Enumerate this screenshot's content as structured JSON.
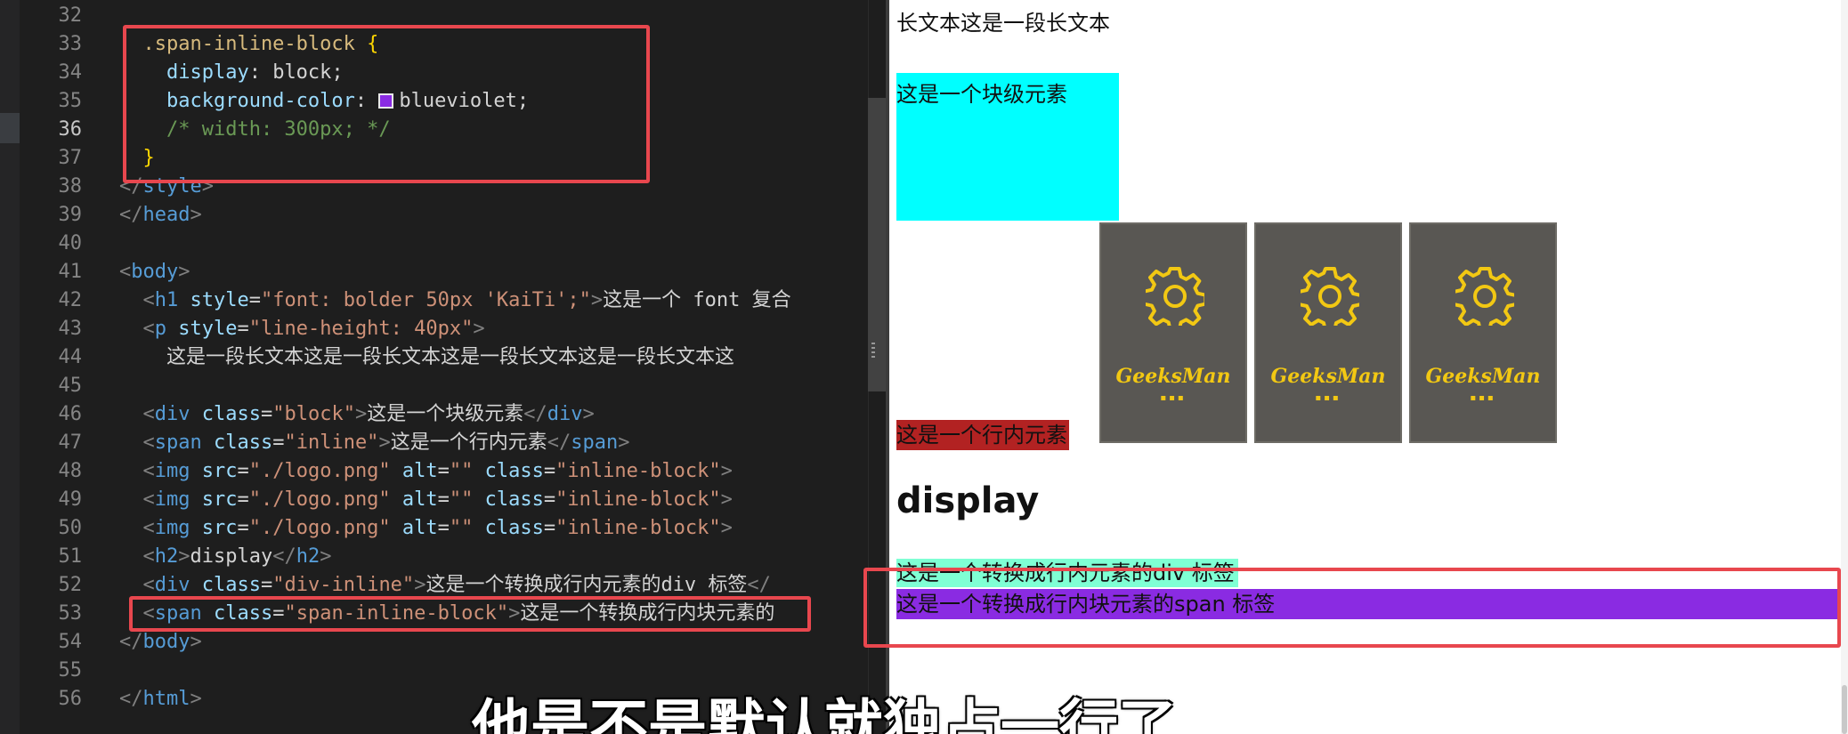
{
  "editor": {
    "lines": [
      {
        "n": "32",
        "tokens": [
          {
            "t": "",
            "c": "t-text"
          }
        ]
      },
      {
        "n": "33",
        "tokens": [
          {
            "t": "  .span-inline-block ",
            "c": "t-sel"
          },
          {
            "t": "{",
            "c": "t-brace"
          }
        ]
      },
      {
        "n": "34",
        "tokens": [
          {
            "t": "    display",
            "c": "t-attr"
          },
          {
            "t": ": block;",
            "c": "t-text"
          }
        ]
      },
      {
        "n": "35",
        "tokens": [
          {
            "t": "    background-color",
            "c": "t-attr"
          },
          {
            "t": ": ",
            "c": "t-text"
          },
          {
            "swatch": "#8a2be2"
          },
          {
            "t": "blueviolet;",
            "c": "t-text"
          }
        ]
      },
      {
        "n": "36",
        "tokens": [
          {
            "t": "    /* width: 300px; */",
            "c": "t-comment"
          }
        ]
      },
      {
        "n": "37",
        "tokens": [
          {
            "t": "  ",
            "c": "t-text"
          },
          {
            "t": "}",
            "c": "t-brace"
          }
        ]
      },
      {
        "n": "38",
        "tokens": [
          {
            "t": "</",
            "c": "t-tag"
          },
          {
            "t": "style",
            "c": "t-name"
          },
          {
            "t": ">",
            "c": "t-tag"
          }
        ]
      },
      {
        "n": "39",
        "tokens": [
          {
            "t": "</",
            "c": "t-tag"
          },
          {
            "t": "head",
            "c": "t-name"
          },
          {
            "t": ">",
            "c": "t-tag"
          }
        ]
      },
      {
        "n": "40",
        "tokens": [
          {
            "t": "",
            "c": "t-text"
          }
        ]
      },
      {
        "n": "41",
        "tokens": [
          {
            "t": "<",
            "c": "t-tag"
          },
          {
            "t": "body",
            "c": "t-name"
          },
          {
            "t": ">",
            "c": "t-tag"
          }
        ]
      },
      {
        "n": "42",
        "tokens": [
          {
            "t": "  <",
            "c": "t-tag"
          },
          {
            "t": "h1",
            "c": "t-name"
          },
          {
            "t": " style",
            "c": "t-attr"
          },
          {
            "t": "=",
            "c": "t-text"
          },
          {
            "t": "\"font: bolder 50px 'KaiTi';\"",
            "c": "t-str"
          },
          {
            "t": ">",
            "c": "t-tag"
          },
          {
            "t": "这是一个 font 复合",
            "c": "t-text"
          }
        ]
      },
      {
        "n": "43",
        "tokens": [
          {
            "t": "  <",
            "c": "t-tag"
          },
          {
            "t": "p",
            "c": "t-name"
          },
          {
            "t": " style",
            "c": "t-attr"
          },
          {
            "t": "=",
            "c": "t-text"
          },
          {
            "t": "\"line-height: 40px\"",
            "c": "t-str"
          },
          {
            "t": ">",
            "c": "t-tag"
          }
        ]
      },
      {
        "n": "44",
        "tokens": [
          {
            "t": "    这是一段长文本这是一段长文本这是一段长文本这是一段长文本这",
            "c": "t-text"
          }
        ]
      },
      {
        "n": "45",
        "tokens": [
          {
            "t": "",
            "c": "t-text"
          }
        ]
      },
      {
        "n": "46",
        "tokens": [
          {
            "t": "  <",
            "c": "t-tag"
          },
          {
            "t": "div",
            "c": "t-name"
          },
          {
            "t": " class",
            "c": "t-attr"
          },
          {
            "t": "=",
            "c": "t-text"
          },
          {
            "t": "\"block\"",
            "c": "t-str"
          },
          {
            "t": ">",
            "c": "t-tag"
          },
          {
            "t": "这是一个块级元素",
            "c": "t-text"
          },
          {
            "t": "</",
            "c": "t-tag"
          },
          {
            "t": "div",
            "c": "t-name"
          },
          {
            "t": ">",
            "c": "t-tag"
          }
        ]
      },
      {
        "n": "47",
        "tokens": [
          {
            "t": "  <",
            "c": "t-tag"
          },
          {
            "t": "span",
            "c": "t-name"
          },
          {
            "t": " class",
            "c": "t-attr"
          },
          {
            "t": "=",
            "c": "t-text"
          },
          {
            "t": "\"inline\"",
            "c": "t-str"
          },
          {
            "t": ">",
            "c": "t-tag"
          },
          {
            "t": "这是一个行内元素",
            "c": "t-text"
          },
          {
            "t": "</",
            "c": "t-tag"
          },
          {
            "t": "span",
            "c": "t-name"
          },
          {
            "t": ">",
            "c": "t-tag"
          }
        ]
      },
      {
        "n": "48",
        "tokens": [
          {
            "t": "  <",
            "c": "t-tag"
          },
          {
            "t": "img",
            "c": "t-name"
          },
          {
            "t": " src",
            "c": "t-attr"
          },
          {
            "t": "=",
            "c": "t-text"
          },
          {
            "t": "\"./logo.png\"",
            "c": "t-str"
          },
          {
            "t": " alt",
            "c": "t-attr"
          },
          {
            "t": "=",
            "c": "t-text"
          },
          {
            "t": "\"\"",
            "c": "t-str"
          },
          {
            "t": " class",
            "c": "t-attr"
          },
          {
            "t": "=",
            "c": "t-text"
          },
          {
            "t": "\"inline-block\"",
            "c": "t-str"
          },
          {
            "t": ">",
            "c": "t-tag"
          }
        ]
      },
      {
        "n": "49",
        "tokens": [
          {
            "t": "  <",
            "c": "t-tag"
          },
          {
            "t": "img",
            "c": "t-name"
          },
          {
            "t": " src",
            "c": "t-attr"
          },
          {
            "t": "=",
            "c": "t-text"
          },
          {
            "t": "\"./logo.png\"",
            "c": "t-str"
          },
          {
            "t": " alt",
            "c": "t-attr"
          },
          {
            "t": "=",
            "c": "t-text"
          },
          {
            "t": "\"\"",
            "c": "t-str"
          },
          {
            "t": " class",
            "c": "t-attr"
          },
          {
            "t": "=",
            "c": "t-text"
          },
          {
            "t": "\"inline-block\"",
            "c": "t-str"
          },
          {
            "t": ">",
            "c": "t-tag"
          }
        ]
      },
      {
        "n": "50",
        "tokens": [
          {
            "t": "  <",
            "c": "t-tag"
          },
          {
            "t": "img",
            "c": "t-name"
          },
          {
            "t": " src",
            "c": "t-attr"
          },
          {
            "t": "=",
            "c": "t-text"
          },
          {
            "t": "\"./logo.png\"",
            "c": "t-str"
          },
          {
            "t": " alt",
            "c": "t-attr"
          },
          {
            "t": "=",
            "c": "t-text"
          },
          {
            "t": "\"\"",
            "c": "t-str"
          },
          {
            "t": " class",
            "c": "t-attr"
          },
          {
            "t": "=",
            "c": "t-text"
          },
          {
            "t": "\"inline-block\"",
            "c": "t-str"
          },
          {
            "t": ">",
            "c": "t-tag"
          }
        ]
      },
      {
        "n": "51",
        "tokens": [
          {
            "t": "  <",
            "c": "t-tag"
          },
          {
            "t": "h2",
            "c": "t-name"
          },
          {
            "t": ">",
            "c": "t-tag"
          },
          {
            "t": "display",
            "c": "t-text"
          },
          {
            "t": "</",
            "c": "t-tag"
          },
          {
            "t": "h2",
            "c": "t-name"
          },
          {
            "t": ">",
            "c": "t-tag"
          }
        ]
      },
      {
        "n": "52",
        "tokens": [
          {
            "t": "  <",
            "c": "t-tag"
          },
          {
            "t": "div",
            "c": "t-name"
          },
          {
            "t": " class",
            "c": "t-attr"
          },
          {
            "t": "=",
            "c": "t-text"
          },
          {
            "t": "\"div-inline\"",
            "c": "t-str"
          },
          {
            "t": ">",
            "c": "t-tag"
          },
          {
            "t": "这是一个转换成行内元素的div 标签",
            "c": "t-text"
          },
          {
            "t": "</",
            "c": "t-tag"
          }
        ]
      },
      {
        "n": "53",
        "tokens": [
          {
            "t": "  <",
            "c": "t-tag"
          },
          {
            "t": "span",
            "c": "t-name"
          },
          {
            "t": " class",
            "c": "t-attr"
          },
          {
            "t": "=",
            "c": "t-text"
          },
          {
            "t": "\"span-inline-block\"",
            "c": "t-str"
          },
          {
            "t": ">",
            "c": "t-tag"
          },
          {
            "t": "这是一个转换成行内块元素的",
            "c": "t-text"
          }
        ]
      },
      {
        "n": "54",
        "tokens": [
          {
            "t": "</",
            "c": "t-tag"
          },
          {
            "t": "body",
            "c": "t-name"
          },
          {
            "t": ">",
            "c": "t-tag"
          }
        ]
      },
      {
        "n": "55",
        "tokens": [
          {
            "t": "",
            "c": "t-text"
          }
        ]
      },
      {
        "n": "56",
        "tokens": [
          {
            "t": "</",
            "c": "t-tag"
          },
          {
            "t": "html",
            "c": "t-name"
          },
          {
            "t": ">",
            "c": "t-tag"
          }
        ]
      }
    ],
    "active_line": "36"
  },
  "preview": {
    "long_text": "长文本这是一段长文本",
    "block_label": "这是一个块级元素",
    "inline_label": "这是一个行内元素",
    "logos": [
      {
        "word": "GeeksMan",
        "dots": "▪▪▪"
      },
      {
        "word": "GeeksMan",
        "dots": "▪▪▪"
      },
      {
        "word": "GeeksMan",
        "dots": "▪▪▪"
      }
    ],
    "h2": "display",
    "div_inline": "这是一个转换成行内元素的div 标签",
    "span_block": "这是一个转换成行内块元素的span 标签"
  },
  "colors": {
    "highlight": "#e8474e",
    "block_bg": "#00ffff",
    "inline_bg": "#b22222",
    "div_inline_bg": "#7fffd4",
    "span_block_bg": "#8a2be2"
  },
  "subtitle": "他是不是默认就独占一行了"
}
